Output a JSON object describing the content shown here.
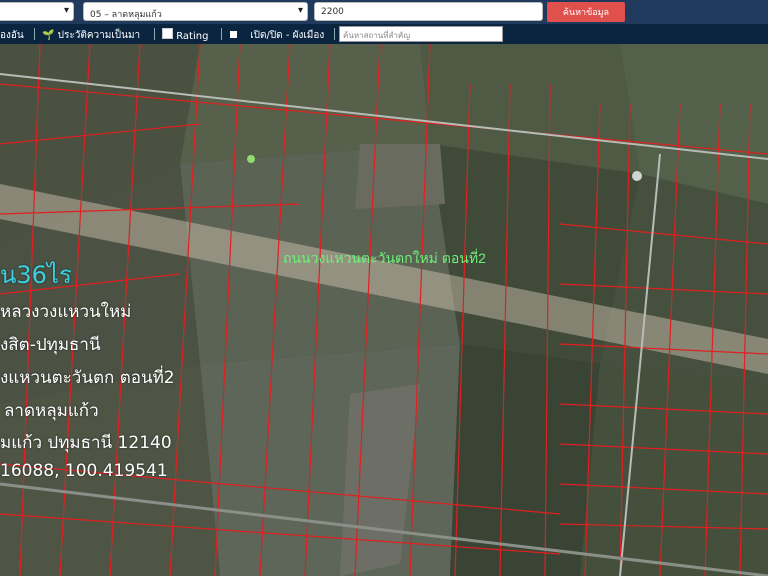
{
  "header": {
    "province_select": "",
    "district_select": "05 – ลาดหลุมแก้ว",
    "code_input": "2200",
    "search_button": "ค้นหาข้อมูล"
  },
  "toolbar": {
    "item1": "องอัน",
    "item2": "ประวัติความเป็นมา",
    "rating": "Rating",
    "toggle_layers": "เปิด/ปิด - ผังเมือง",
    "place_search_placeholder": "ค้นหาสถานที่สำคัญ"
  },
  "map": {
    "road_label": "ถนนวงแหวนตะวันตกใหม่ ตอนที่2",
    "info": {
      "area": "น36ไร",
      "line1": "หลวงวงแหวนใหม่",
      "line2": "งสิต-ปทุมธานี",
      "line3": "งแหวนตะวันตก ตอนที่2",
      "line4": "ลาดหลุมแก้ว",
      "line5": "มแก้ว ปทุมธานี 12140",
      "coords": "16088, 100.419541"
    }
  },
  "colors": {
    "header_bg": "#1f3a5c",
    "toolbar_bg": "#0b2540",
    "button": "#e0504d",
    "parcel_lines": "#e02020"
  }
}
